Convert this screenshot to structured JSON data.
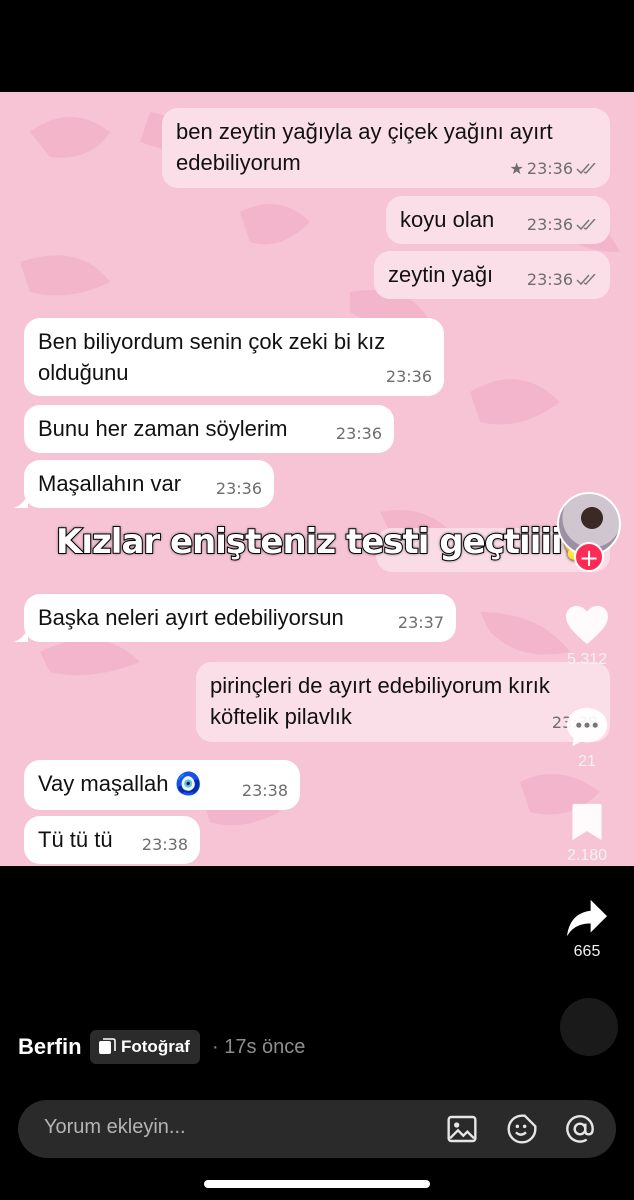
{
  "chat": {
    "messages": [
      {
        "text": "ben zeytin yağıyla ay çiçek yağını ayırt edebiliyorum",
        "time": "23:36",
        "starred": true,
        "direction": "out"
      },
      {
        "text": "koyu olan",
        "time": "23:36",
        "direction": "out"
      },
      {
        "text": "zeytin yağı",
        "time": "23:36",
        "direction": "out"
      },
      {
        "text": "Ben biliyordum senin çok zeki bi kız olduğunu",
        "time": "23:36",
        "direction": "in"
      },
      {
        "text": "Bunu her zaman söylerim",
        "time": "23:36",
        "direction": "in"
      },
      {
        "text": "Maşallahın var",
        "time": "23:36",
        "direction": "in"
      },
      {
        "text": "Başka neleri ayırt edebiliyorsun",
        "time": "23:37",
        "direction": "in"
      },
      {
        "text": "pirinçleri de ayırt edebiliyorum kırık köftelik pilavlık",
        "time": "23:38",
        "direction": "out"
      },
      {
        "text": "Vay maşallah 🧿",
        "time": "23:38",
        "direction": "in"
      },
      {
        "text": "Tü tü tü",
        "time": "23:38",
        "direction": "in"
      }
    ],
    "star_glyph": "★"
  },
  "overlay": {
    "caption": "Kızlar enişteniz testi geçtiiii",
    "emoji": "🥱"
  },
  "actions": {
    "likes": "5.312",
    "comments": "21",
    "saves": "2.180",
    "shares": "665"
  },
  "post": {
    "author": "Berfin",
    "type_label": "Fotoğraf",
    "time_ago": "· 17s önce"
  },
  "comment": {
    "placeholder": "Yorum ekleyin..."
  },
  "icons": {
    "like": "heart-icon",
    "comment": "comment-icon",
    "save": "bookmark-icon",
    "share": "share-icon",
    "image": "image-icon",
    "emoji": "emoji-icon",
    "mention": "at-icon"
  },
  "colors": {
    "background": "#000000",
    "chat_wallpaper": "#f6c4d5",
    "bubble_out": "#fbdfe8",
    "bubble_in": "#ffffff",
    "follow": "#fe2c55"
  }
}
